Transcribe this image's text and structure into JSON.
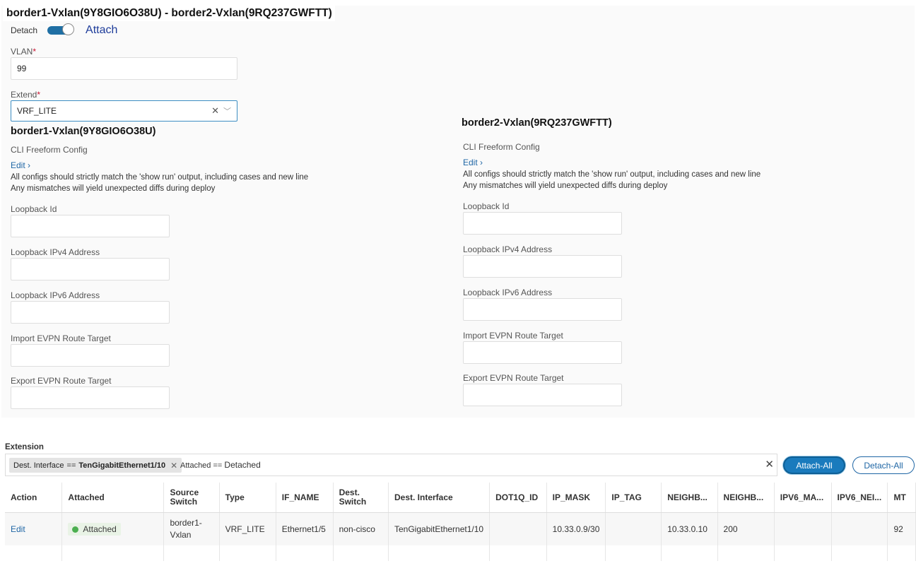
{
  "header": {
    "title": "border1-Vxlan(9Y8GIO6O38U) - border2-Vxlan(9RQ237GWFTT)"
  },
  "toggle": {
    "off_label": "Detach",
    "on_label": "Attach",
    "state": "on"
  },
  "vlan": {
    "label": "VLAN",
    "value": "99"
  },
  "extend": {
    "label": "Extend",
    "value": "VRF_LITE",
    "clear_icon": "close-icon",
    "dropdown_icon": "chevron-down-icon"
  },
  "required_marker": "*",
  "switches": [
    {
      "title": "border1-Vxlan(9Y8GIO6O38U)",
      "cli_label": "CLI Freeform Config",
      "edit_label": "Edit",
      "edit_icon": "chevron-right-icon",
      "note1": "All configs should strictly match the 'show run' output, including cases and new line",
      "note2": "Any mismatches will yield unexpected diffs during deploy",
      "fields": [
        {
          "label": "Loopback Id",
          "value": ""
        },
        {
          "label": "Loopback IPv4 Address",
          "value": ""
        },
        {
          "label": "Loopback IPv6 Address",
          "value": ""
        },
        {
          "label": "Import EVPN Route Target",
          "value": ""
        },
        {
          "label": "Export EVPN Route Target",
          "value": ""
        }
      ]
    },
    {
      "title": "border2-Vxlan(9RQ237GWFTT)",
      "cli_label": "CLI Freeform Config",
      "edit_label": "Edit",
      "edit_icon": "chevron-right-icon",
      "note1": "All configs should strictly match the 'show run' output, including cases and new line",
      "note2": "Any mismatches will yield unexpected diffs during deploy",
      "fields": [
        {
          "label": "Loopback Id",
          "value": ""
        },
        {
          "label": "Loopback IPv4 Address",
          "value": ""
        },
        {
          "label": "Loopback IPv6 Address",
          "value": ""
        },
        {
          "label": "Import EVPN Route Target",
          "value": ""
        },
        {
          "label": "Export EVPN Route Target",
          "value": ""
        }
      ]
    }
  ],
  "extension": {
    "label": "Extension",
    "filter_chip": {
      "key": "Dest. Interface",
      "op": "==",
      "value": "TenGigabitEthernet1/10"
    },
    "filter_text": {
      "key": "Attached",
      "op": "==",
      "value": "Detached"
    },
    "attach_all": "Attach-All",
    "detach_all": "Detach-All",
    "columns": [
      "Action",
      "Attached",
      "Source Switch",
      "Type",
      "IF_NAME",
      "Dest. Switch",
      "Dest. Interface",
      "DOT1Q_ID",
      "IP_MASK",
      "IP_TAG",
      "NEIGHB...",
      "NEIGHB...",
      "IPV6_MA...",
      "IPV6_NEI...",
      "MT"
    ],
    "rows": [
      {
        "action": "Edit",
        "attached": "Attached",
        "source_switch": "border1-Vxlan",
        "type": "VRF_LITE",
        "if_name": "Ethernet1/5",
        "dest_switch": "non-cisco",
        "dest_interface": "TenGigabitEthernet1/10",
        "dot1q_id": "",
        "ip_mask": "10.33.0.9/30",
        "ip_tag": "",
        "neighbor_ip": "10.33.0.10",
        "neighbor_asn": "200",
        "ipv6_mask": "",
        "ipv6_neighbor": "",
        "mtu": "92"
      }
    ],
    "status_color": "#4caf50"
  }
}
